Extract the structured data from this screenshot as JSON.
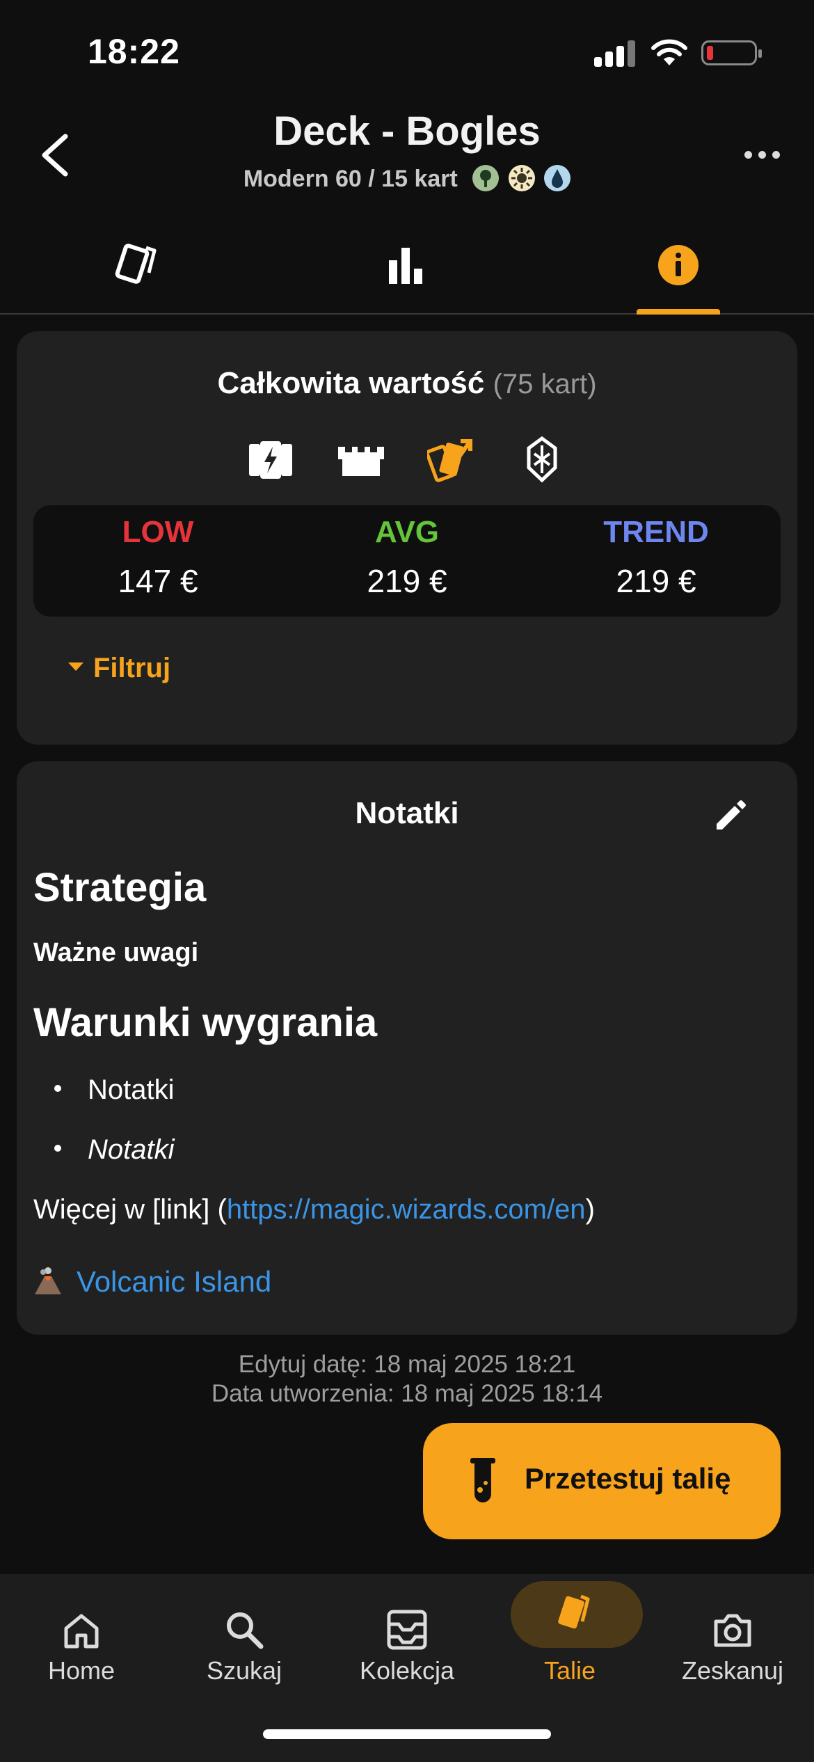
{
  "status_bar": {
    "time": "18:22"
  },
  "header": {
    "title": "Deck - Bogles",
    "subtitle": "Modern 60 / 15 kart"
  },
  "tabs": [
    {
      "icon": "cards-icon",
      "active": false
    },
    {
      "icon": "bar-chart-icon",
      "active": false
    },
    {
      "icon": "info-icon",
      "active": true
    }
  ],
  "value_card": {
    "title": "Całkowita wartość",
    "count": "(75 kart)",
    "price_sources": [
      "card-market-icon",
      "tcg-player-icon",
      "card-kingdom-icon",
      "mtgo-icon"
    ],
    "prices": [
      {
        "label": "LOW",
        "value": "147 €",
        "color": "#e5343a"
      },
      {
        "label": "AVG",
        "value": "219 €",
        "color": "#64c43a"
      },
      {
        "label": "TREND",
        "value": "219 €",
        "color": "#6e86f0"
      }
    ],
    "filter_label": "Filtruj"
  },
  "notes_card": {
    "title": "Notatki",
    "heading1": "Strategia",
    "bold_text": "Ważne uwagi",
    "heading2": "Warunki wygrania",
    "list_items": [
      "Notatki",
      "Notatki"
    ],
    "more_prefix": "Więcej w [link] (",
    "more_link": "https://magic.wizards.com/en",
    "more_suffix": ")",
    "card_link": "Volcanic Island"
  },
  "dates": {
    "edited": "Edytuj datę: 18 maj 2025 18:21",
    "created": "Data utworzenia: 18 maj 2025 18:14"
  },
  "fab": {
    "label": "Przetestuj talię"
  },
  "bottom_nav": [
    {
      "label": "Home",
      "icon": "home-icon"
    },
    {
      "label": "Szukaj",
      "icon": "search-icon"
    },
    {
      "label": "Kolekcja",
      "icon": "collection-icon"
    },
    {
      "label": "Talie",
      "icon": "decks-icon",
      "active": true
    },
    {
      "label": "Zeskanuj",
      "icon": "camera-icon"
    }
  ],
  "colors": {
    "accent": "#f7a31b",
    "link": "#3a95e6",
    "card_bg": "#212121"
  }
}
